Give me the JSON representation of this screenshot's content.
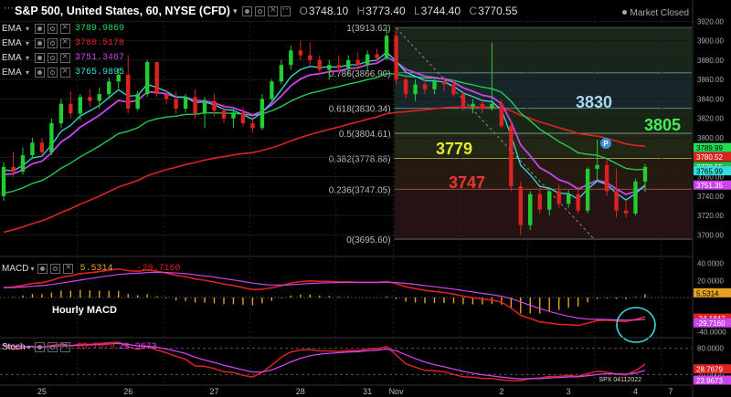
{
  "header": {
    "symbol": "S&P 500, United States, 60, NYSE (CFD)",
    "ohlc": [
      {
        "key": "O",
        "value": "3748.10"
      },
      {
        "key": "H",
        "value": "3773.40"
      },
      {
        "key": "L",
        "value": "3744.40"
      },
      {
        "key": "C",
        "value": "3770.55"
      }
    ],
    "market_status": "Market Closed"
  },
  "ema_legend": [
    {
      "label": "EMA",
      "value": "3789.9869",
      "color": "#22dd55"
    },
    {
      "label": "EMA",
      "value": "3780.5178",
      "color": "#dd2222"
    },
    {
      "label": "EMA",
      "value": "3751.3467",
      "color": "#cc44ee"
    },
    {
      "label": "EMA",
      "value": "3765.9895",
      "color": "#33dddd"
    }
  ],
  "annotations": {
    "fib_levels": [
      {
        "label": "1(3913.62)",
        "price": 3913.62
      },
      {
        "label": "0.786(3866.90)",
        "price": 3866.9
      },
      {
        "label": "0.618(3830.34)",
        "price": 3830.34
      },
      {
        "label": "0.5(3804.61)",
        "price": 3804.61
      },
      {
        "label": "0.382(3778.88)",
        "price": 3778.88
      },
      {
        "label": "0.236(3747.05)",
        "price": 3747.05
      },
      {
        "label": "0(3695.60)",
        "price": 3695.6
      }
    ],
    "big_labels": [
      {
        "text": "3830",
        "price": 3830,
        "color": "#a9d8f0"
      },
      {
        "text": "3805",
        "price": 3805,
        "color": "#44ee55"
      },
      {
        "text": "3779",
        "price": 3779,
        "color": "#e8e82a"
      },
      {
        "text": "3747",
        "price": 3747,
        "color": "#ee3333"
      }
    ],
    "hourly_macd_label": "Hourly MACD",
    "macd_cross_circle": true,
    "fib_zones": [
      {
        "from": 3913.62,
        "to": 3866.9,
        "color": "#1e2a1e"
      },
      {
        "from": 3866.9,
        "to": 3830.34,
        "color": "#1a2a2e"
      },
      {
        "from": 3830.34,
        "to": 3804.61,
        "color": "#1c2a1a"
      },
      {
        "from": 3804.61,
        "to": 3778.88,
        "color": "#262a16"
      },
      {
        "from": 3778.88,
        "to": 3747.05,
        "color": "#2a1c12"
      },
      {
        "from": 3747.05,
        "to": 3695.6,
        "color": "#2a1414"
      }
    ],
    "event_marker": "P"
  },
  "price_axis": {
    "ticks": [
      "3920.00",
      "3900.00",
      "3880.00",
      "3860.00",
      "3840.00",
      "3820.00",
      "3800.00",
      "3780.00",
      "3760.00",
      "3740.00",
      "3720.00",
      "3700.00"
    ],
    "price_labels": [
      {
        "text": "3789.99",
        "price": 3789.99,
        "bg": "#22dd55",
        "fg": "#000"
      },
      {
        "text": "3780.52",
        "price": 3780.52,
        "bg": "#dd2222",
        "fg": "#fff"
      },
      {
        "text": "3770.55",
        "price": 3770.55,
        "bg": "#22bb44",
        "fg": "#fff"
      },
      {
        "text": "3765.99",
        "price": 3765.99,
        "bg": "#33dddd",
        "fg": "#000"
      },
      {
        "text": "3751.35",
        "price": 3751.35,
        "bg": "#cc44ee",
        "fg": "#fff"
      }
    ]
  },
  "macd": {
    "label": "MACD",
    "values": [
      "5.5314",
      "-29.7160"
    ],
    "axis_ticks": [
      "40.0000",
      "20.0000",
      "-40.0000"
    ],
    "price_labels": [
      {
        "text": "5.5314",
        "bg": "#e8a020",
        "fg": "#000",
        "value": 5.53
      },
      {
        "text": "-24.1847",
        "bg": "#dd2222",
        "fg": "#fff",
        "value": -24.18
      },
      {
        "text": "-29.7160",
        "bg": "#cc44ee",
        "fg": "#fff",
        "value": -29.72
      }
    ]
  },
  "stoch": {
    "label": "Stoch",
    "values": [
      "28.7679",
      "23.9673"
    ],
    "axis_ticks": [
      "80.0000",
      "20.0000"
    ],
    "price_labels": [
      {
        "text": "28.7679",
        "bg": "#dd2222",
        "fg": "#fff",
        "value": 28.77
      },
      {
        "text": "23.9673",
        "bg": "#cc44ee",
        "fg": "#fff",
        "value": 23.97
      }
    ],
    "watermark": "SPX 04112022"
  },
  "time_axis": [
    "25",
    "26",
    "27",
    "28",
    "31",
    "Nov",
    "2",
    "3",
    "4",
    "7"
  ],
  "colors": {
    "up": "#22cc33",
    "down": "#dd2222",
    "ema_fast": "#33dddd",
    "ema_mid": "#cc44ee",
    "ema_slow": "#22cc55",
    "ema_long": "#dd2222",
    "macd_line": "#dd2222",
    "signal_line": "#cc44ee",
    "hist": "#e8a020",
    "circle": "#33dddd"
  },
  "candles": [
    [
      3740,
      3775,
      3735,
      3770
    ],
    [
      3770,
      3785,
      3760,
      3765
    ],
    [
      3765,
      3790,
      3762,
      3782
    ],
    [
      3782,
      3800,
      3778,
      3795
    ],
    [
      3795,
      3800,
      3780,
      3785
    ],
    [
      3785,
      3820,
      3782,
      3815
    ],
    [
      3815,
      3840,
      3810,
      3835
    ],
    [
      3835,
      3848,
      3820,
      3825
    ],
    [
      3825,
      3845,
      3818,
      3842
    ],
    [
      3842,
      3850,
      3832,
      3838
    ],
    [
      3838,
      3852,
      3830,
      3845
    ],
    [
      3845,
      3862,
      3840,
      3858
    ],
    [
      3858,
      3872,
      3850,
      3865
    ],
    [
      3865,
      3885,
      3825,
      3830
    ],
    [
      3830,
      3848,
      3828,
      3845
    ],
    [
      3845,
      3880,
      3842,
      3878
    ],
    [
      3878,
      3870,
      3842,
      3845
    ],
    [
      3845,
      3850,
      3835,
      3840
    ],
    [
      3840,
      3848,
      3825,
      3830
    ],
    [
      3830,
      3845,
      3826,
      3842
    ],
    [
      3842,
      3850,
      3820,
      3825
    ],
    [
      3825,
      3842,
      3810,
      3838
    ],
    [
      3838,
      3845,
      3822,
      3828
    ],
    [
      3828,
      3835,
      3815,
      3820
    ],
    [
      3820,
      3830,
      3810,
      3826
    ],
    [
      3826,
      3832,
      3812,
      3815
    ],
    [
      3815,
      3822,
      3805,
      3810
    ],
    [
      3810,
      3845,
      3808,
      3840
    ],
    [
      3840,
      3860,
      3838,
      3858
    ],
    [
      3858,
      3880,
      3855,
      3875
    ],
    [
      3875,
      3895,
      3870,
      3890
    ],
    [
      3890,
      3900,
      3880,
      3885
    ],
    [
      3885,
      3898,
      3875,
      3880
    ],
    [
      3880,
      3885,
      3865,
      3870
    ],
    [
      3870,
      3880,
      3860,
      3875
    ],
    [
      3875,
      3885,
      3868,
      3872
    ],
    [
      3872,
      3885,
      3865,
      3880
    ],
    [
      3880,
      3888,
      3870,
      3875
    ],
    [
      3875,
      3890,
      3868,
      3886
    ],
    [
      3886,
      3892,
      3878,
      3882
    ],
    [
      3882,
      3913,
      3880,
      3905
    ],
    [
      3905,
      3910,
      3855,
      3860
    ],
    [
      3860,
      3865,
      3840,
      3845
    ],
    [
      3845,
      3860,
      3838,
      3855
    ],
    [
      3855,
      3862,
      3845,
      3850
    ],
    [
      3850,
      3860,
      3845,
      3858
    ],
    [
      3858,
      3863,
      3848,
      3855
    ],
    [
      3855,
      3860,
      3842,
      3845
    ],
    [
      3845,
      3848,
      3828,
      3832
    ],
    [
      3832,
      3840,
      3825,
      3835
    ],
    [
      3835,
      3840,
      3825,
      3830
    ],
    [
      3830,
      3898,
      3828,
      3835
    ],
    [
      3835,
      3840,
      3810,
      3812
    ],
    [
      3812,
      3818,
      3745,
      3750
    ],
    [
      3750,
      3755,
      3700,
      3710
    ],
    [
      3710,
      3745,
      3705,
      3742
    ],
    [
      3742,
      3748,
      3722,
      3726
    ],
    [
      3726,
      3748,
      3720,
      3745
    ],
    [
      3745,
      3752,
      3728,
      3732
    ],
    [
      3732,
      3746,
      3728,
      3742
    ],
    [
      3742,
      3750,
      3722,
      3725
    ],
    [
      3725,
      3770,
      3722,
      3768
    ],
    [
      3768,
      3798,
      3755,
      3772
    ],
    [
      3772,
      3778,
      3740,
      3745
    ],
    [
      3745,
      3768,
      3718,
      3725
    ],
    [
      3725,
      3735,
      3718,
      3722
    ],
    [
      3722,
      3758,
      3720,
      3755
    ],
    [
      3755,
      3773,
      3744,
      3770
    ]
  ]
}
